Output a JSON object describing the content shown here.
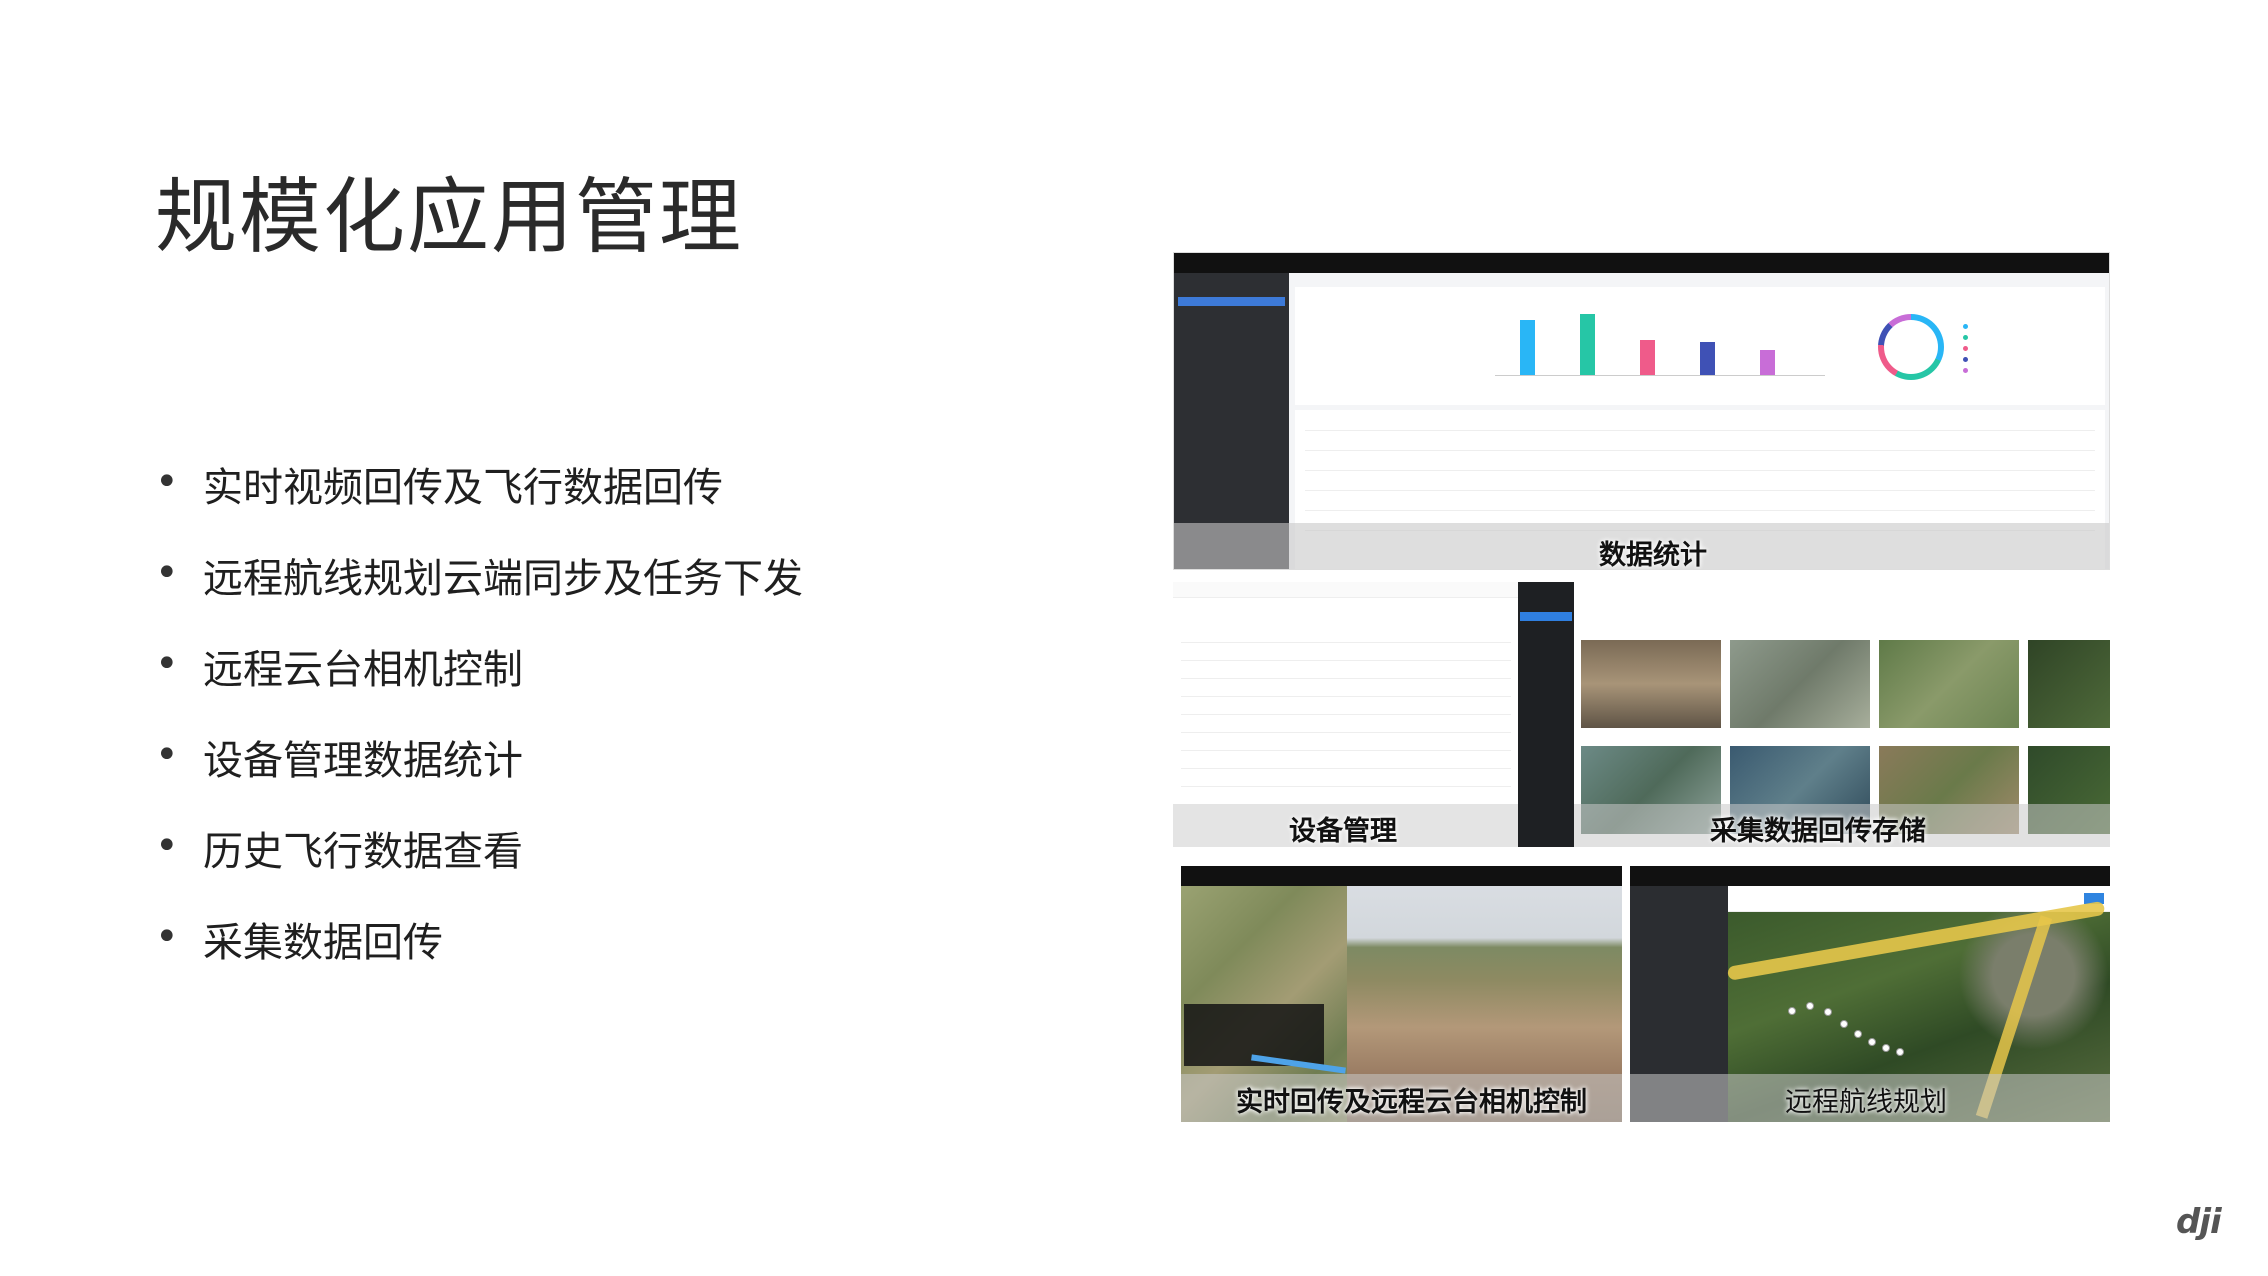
{
  "slide": {
    "title": "规模化应用管理",
    "bullets": [
      "实时视频回传及飞行数据回传",
      "远程航线规划云端同步及任务下发",
      "远程云台相机控制",
      "设备管理数据统计",
      "历史飞行数据查看",
      "采集数据回传"
    ]
  },
  "screenshots": {
    "data_stats": {
      "caption": "数据统计"
    },
    "device_management": {
      "caption": "设备管理"
    },
    "collected_data": {
      "caption": "采集数据回传存储"
    },
    "live_video": {
      "caption": "实时回传及远程云台相机控制"
    },
    "route_planning": {
      "caption": "远程航线规划"
    }
  },
  "logo": {
    "text": "dji"
  },
  "colors": {
    "bar_blue": "#29b6f6",
    "bar_green": "#26c6a6",
    "bar_pink": "#ef5b8a",
    "bar_indigo": "#3f51b5",
    "bar_violet": "#c86dd7",
    "accent_blue": "#2f84e0"
  }
}
